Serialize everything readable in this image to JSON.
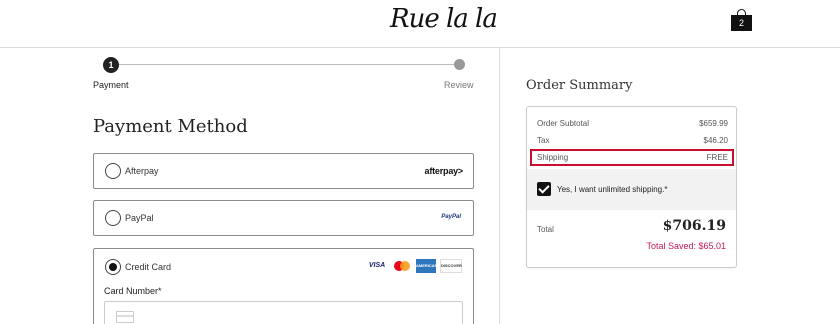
{
  "header": {
    "logo_text": "Rue la la",
    "bag_count": "2"
  },
  "stepper": {
    "step1_number": "1",
    "step1_label": "Payment",
    "step2_label": "Review"
  },
  "payment": {
    "title": "Payment Method",
    "options": [
      {
        "label": "Afterpay",
        "logo": "afterpay>",
        "selected": false
      },
      {
        "label": "PayPal",
        "logo": "PayPal",
        "selected": false
      },
      {
        "label": "Credit Card",
        "selected": true
      }
    ],
    "card_logos": {
      "visa": "VISA",
      "amex": "AMERICAN EXPRESS",
      "discover": "DISCOVER"
    },
    "card_number_label": "Card Number*"
  },
  "order_summary": {
    "title": "Order Summary",
    "subtotal_label": "Order Subtotal",
    "subtotal_value": "$659.99",
    "tax_label": "Tax",
    "tax_value": "$46.20",
    "shipping_label": "Shipping",
    "shipping_value": "FREE",
    "unlimited_shipping_text": "Yes, I want unlimited shipping.*",
    "unlimited_shipping_checked": true,
    "total_label": "Total",
    "total_value": "$706.19",
    "saved_text": "Total Saved: $65.01"
  },
  "colors": {
    "highlight": "#c8102e",
    "saved": "#c2185b"
  }
}
